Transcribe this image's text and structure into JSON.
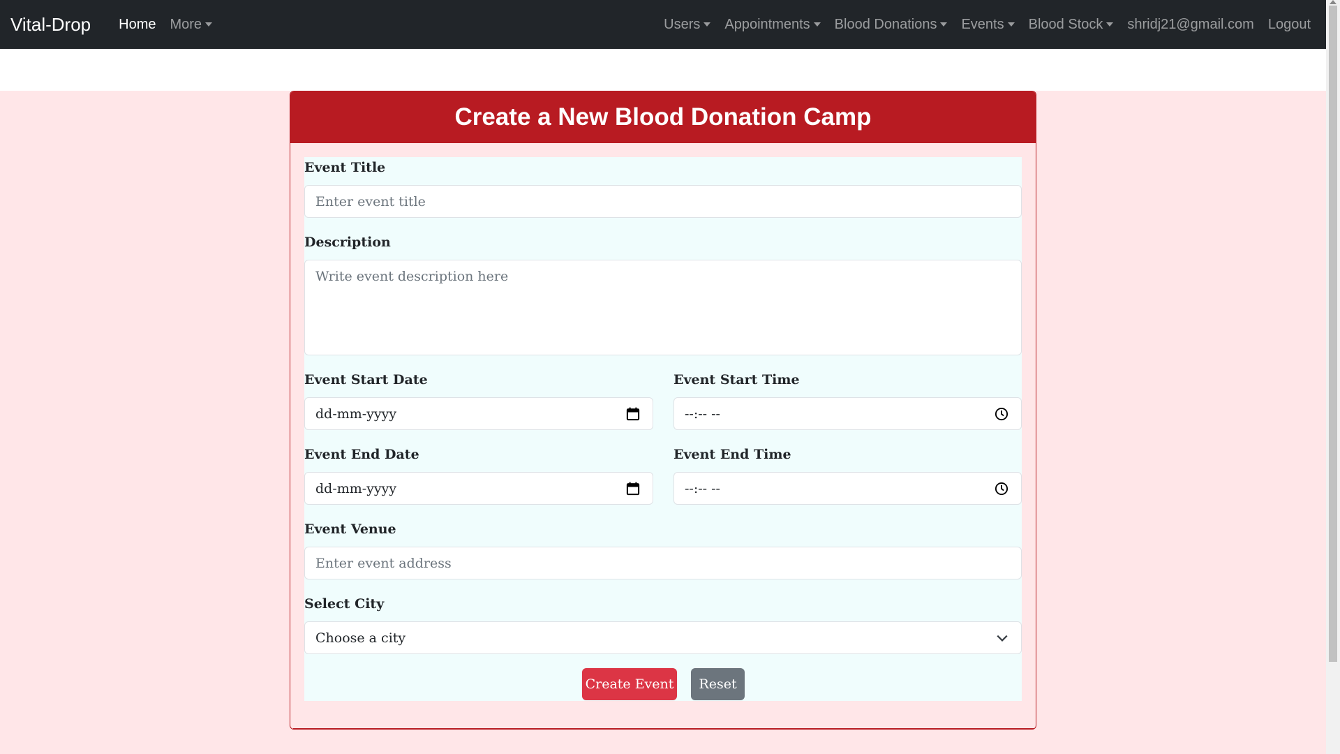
{
  "nav": {
    "brand": "Vital-Drop",
    "home": "Home",
    "more": "More",
    "users": "Users",
    "appointments": "Appointments",
    "blood_donations": "Blood Donations",
    "events": "Events",
    "blood_stock": "Blood Stock",
    "email": "shridj21@gmail.com",
    "logout": "Logout"
  },
  "card": {
    "title": "Create a New Blood Donation Camp"
  },
  "form": {
    "event_title_label": "Event Title",
    "event_title_placeholder": "Enter event title",
    "description_label": "Description",
    "description_placeholder": "Write event description here",
    "start_date_label": "Event Start Date",
    "start_date_value": "dd-mm-yyyy",
    "start_time_label": "Event Start Time",
    "start_time_value": "--:-- --",
    "end_date_label": "Event End Date",
    "end_date_value": "dd-mm-yyyy",
    "end_time_label": "Event End Time",
    "end_time_value": "--:-- --",
    "venue_label": "Event Venue",
    "venue_placeholder": "Enter event address",
    "city_label": "Select City",
    "city_selected": "Choose a city",
    "create_button": "Create Event",
    "reset_button": "Reset"
  },
  "colors": {
    "navbar": "#212529",
    "header": "#b81b22",
    "page_bg": "#ffe6e8",
    "form_bg": "#f0fdfd",
    "create_button": "#dc3545",
    "reset_button": "#6c757d"
  }
}
